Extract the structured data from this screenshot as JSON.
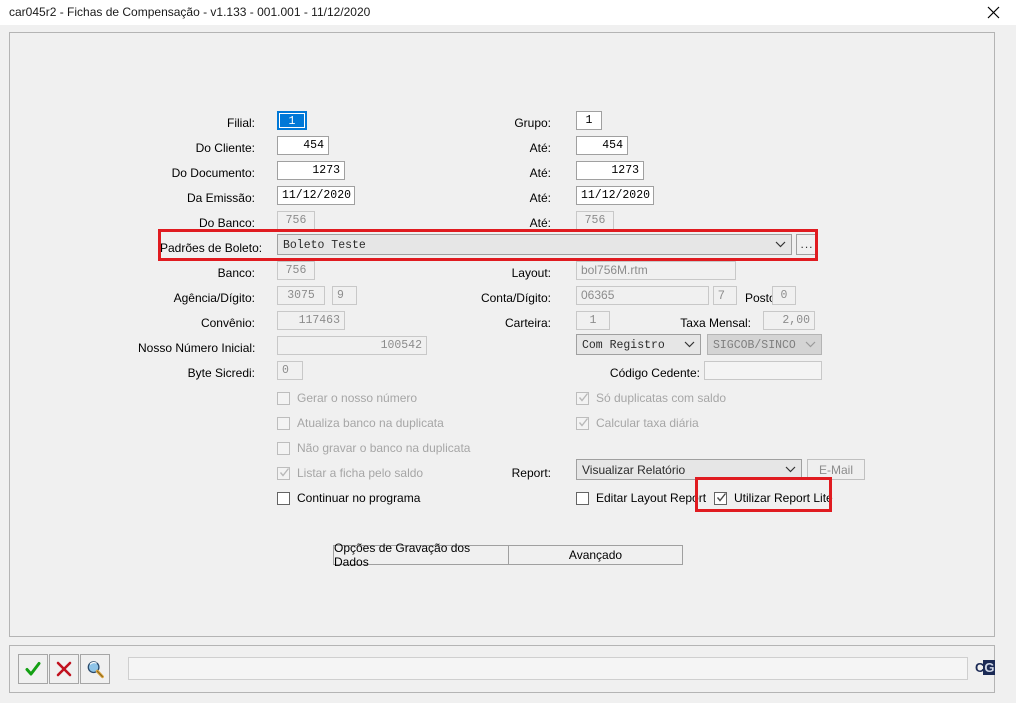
{
  "window": {
    "title": "car045r2 - Fichas de Compensação - v1.133 - 001.001 - 11/12/2020",
    "close_icon": "close-icon"
  },
  "accent": {
    "highlight_red": "#e01b20",
    "selection_blue": "#0078d7"
  },
  "filters": {
    "filial": {
      "label": "Filial:",
      "value": "1"
    },
    "grupo": {
      "label": "Grupo:",
      "value": "1"
    },
    "do_cliente": {
      "label": "Do Cliente:",
      "value": "454"
    },
    "ate_cliente": {
      "label": "Até:",
      "value": "454"
    },
    "do_documento": {
      "label": "Do Documento:",
      "value": "1273"
    },
    "ate_documento": {
      "label": "Até:",
      "value": "1273"
    },
    "da_emissao": {
      "label": "Da Emissão:",
      "value": "11/12/2020"
    },
    "ate_emissao": {
      "label": "Até:",
      "value": "11/12/2020"
    },
    "do_banco": {
      "label": "Do Banco:",
      "value": "756"
    },
    "ate_banco": {
      "label": "Até:",
      "value": "756"
    }
  },
  "padroes": {
    "label": "Padrões de Boleto:",
    "value": "Boleto Teste",
    "browse_label": "...",
    "dropdown_icon": "chevron-down-icon"
  },
  "dados": {
    "banco": {
      "label": "Banco:",
      "value": "756"
    },
    "layout": {
      "label": "Layout:",
      "value": "bol756M.rtm"
    },
    "agencia": {
      "label": "Agência/Dígito:",
      "value": "3075"
    },
    "agencia_digito": {
      "value": "9"
    },
    "conta": {
      "label": "Conta/Dígito:",
      "value": "06365"
    },
    "conta_digito": {
      "value": "7"
    },
    "posto": {
      "label": "Posto:",
      "value": "0"
    },
    "convenio": {
      "label": "Convênio:",
      "value": "117463"
    },
    "carteira": {
      "label": "Carteira:",
      "value": "1"
    },
    "taxa_mensal": {
      "label": "Taxa Mensal:",
      "value": "2,00"
    },
    "nosso_numero": {
      "label": "Nosso Número Inicial:",
      "value": "100542"
    },
    "registro": {
      "value": "Com Registro",
      "dropdown_icon": "chevron-down-icon"
    },
    "sigcob": {
      "value": "SIGCOB/SINCO",
      "dropdown_icon": "chevron-down-icon"
    },
    "byte_sicredi": {
      "label": "Byte Sicredi:",
      "value": "0"
    },
    "codigo_cedente": {
      "label": "Código Cedente:",
      "value": ""
    }
  },
  "options_left": [
    {
      "label": "Gerar o nosso número",
      "checked": false,
      "disabled": true
    },
    {
      "label": "Atualiza banco na duplicata",
      "checked": false,
      "disabled": true
    },
    {
      "label": "Não gravar o banco na duplicata",
      "checked": false,
      "disabled": true
    },
    {
      "label": "Listar a ficha pelo saldo",
      "checked": true,
      "disabled": true
    },
    {
      "label": "Continuar no programa",
      "checked": false,
      "disabled": false
    }
  ],
  "options_right": [
    {
      "label": "Só duplicatas com saldo",
      "checked": true,
      "disabled": true
    },
    {
      "label": "Calcular taxa diária",
      "checked": true,
      "disabled": true
    }
  ],
  "report": {
    "label": "Report:",
    "value": "Visualizar Relatório",
    "dropdown_icon": "chevron-down-icon",
    "email_button": "E-Mail",
    "editar_layout": {
      "label": "Editar Layout Report",
      "checked": false
    },
    "report_lite": {
      "label": "Utilizar Report Lite",
      "checked": true
    }
  },
  "action_buttons": {
    "gravacao": "Opções de Gravação dos Dados",
    "avancado": "Avançado"
  },
  "toolbar": {
    "confirm_icon": "check-icon",
    "cancel_icon": "x-icon",
    "search_icon": "magnifier-icon",
    "status_value": "",
    "logo_a": "C",
    "logo_b": "G"
  }
}
